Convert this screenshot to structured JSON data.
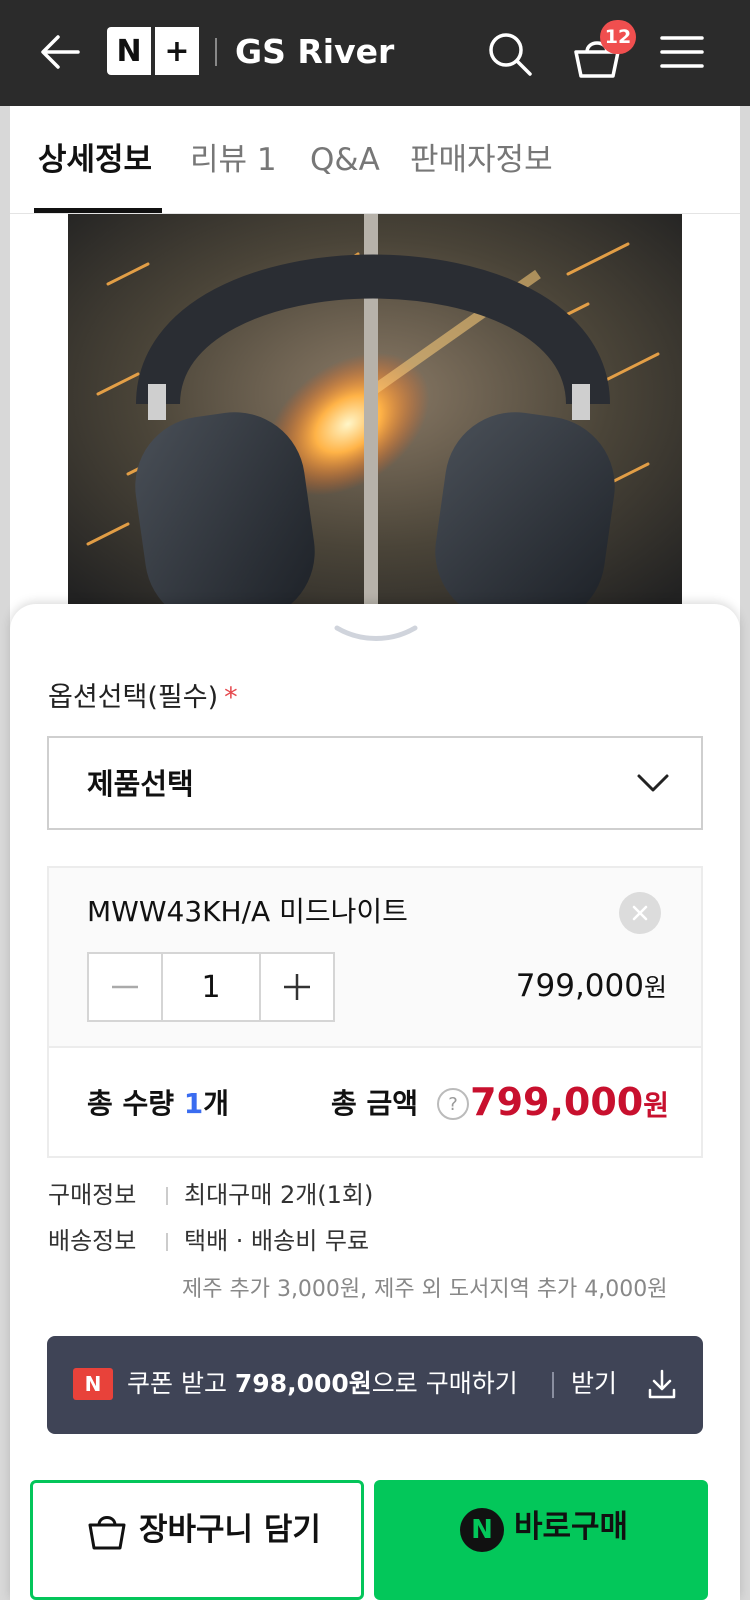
{
  "header": {
    "logo_n": "N",
    "logo_plus": "+",
    "store_name": "GS River",
    "cart_count": "12"
  },
  "tabs": [
    {
      "label": "상세정보",
      "active": true
    },
    {
      "label": "리뷰 1",
      "active": false
    },
    {
      "label": "Q&A",
      "active": false
    },
    {
      "label": "판매자정보",
      "active": false
    }
  ],
  "options": {
    "label": "옵션선택(필수)",
    "required_mark": "*",
    "select_value": "제품선택"
  },
  "selected_item": {
    "name": "MWW43KH/A 미드나이트",
    "quantity": "1",
    "price": "799,000",
    "currency": "원"
  },
  "total": {
    "qty_label": "총 수량",
    "qty_value": "1",
    "qty_unit": "개",
    "amount_label": "총 금액",
    "help": "?",
    "amount": "799,000",
    "currency": "원"
  },
  "purchase_info": {
    "label": "구매정보",
    "value": "최대구매 2개(1회)"
  },
  "shipping_info": {
    "label": "배송정보",
    "value": "택배 · 배송비 무료",
    "note": "제주 추가 3,000원, 제주 외 도서지역 추가 4,000원"
  },
  "coupon": {
    "badge": "N",
    "text_pre": "쿠폰 받고 ",
    "price": "798,000원",
    "text_post": "으로 구매하기",
    "receive_label": "받기"
  },
  "actions": {
    "cart_label": "장바구니 담기",
    "buy_badge": "N",
    "buy_label": "바로구매"
  },
  "colors": {
    "header_bg": "#2b2b2b",
    "badge": "#f04f4f",
    "price_red": "#c8102e",
    "qty_blue": "#3a6cf0",
    "coupon_bg": "#3f4456",
    "naver_green": "#03c75a"
  }
}
